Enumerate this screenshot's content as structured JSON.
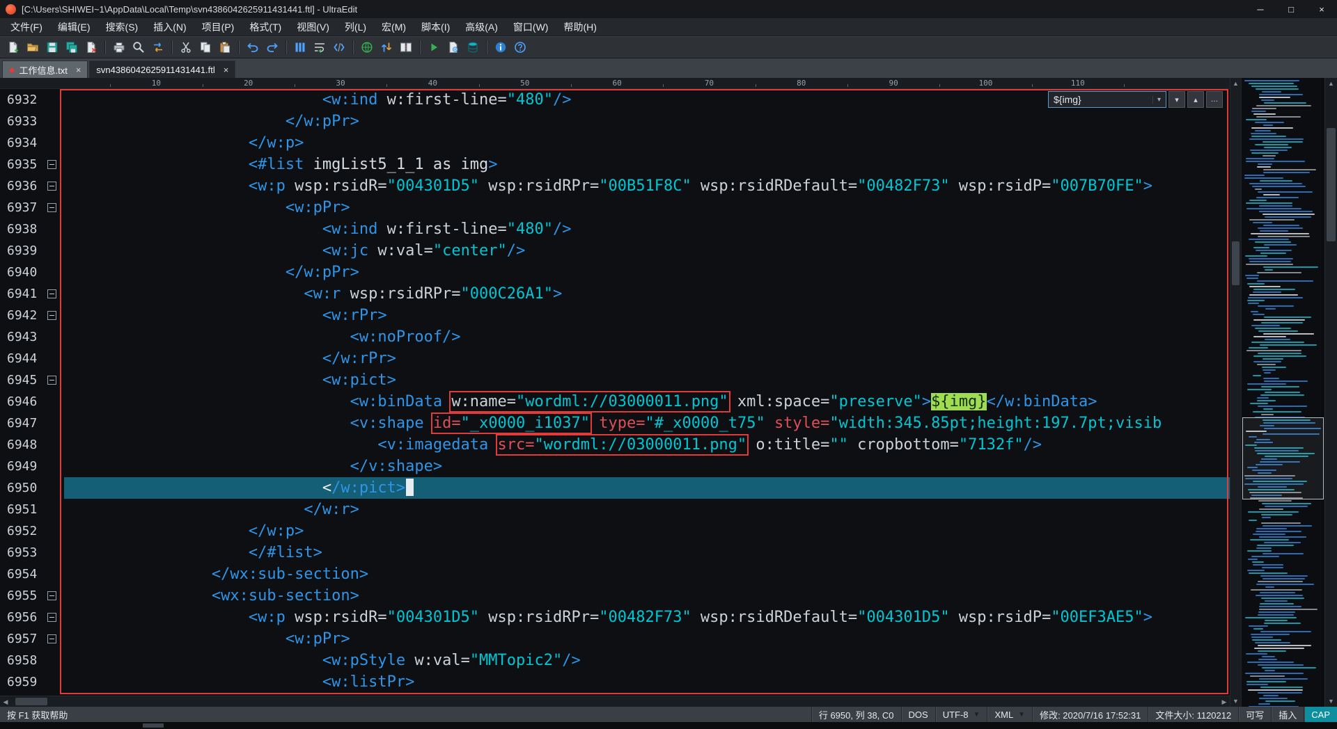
{
  "window": {
    "title": "[C:\\Users\\SHIWEI~1\\AppData\\Local\\Temp\\svn4386042625911431441.ftl] - UltraEdit",
    "controls": [
      {
        "name": "minimize"
      },
      {
        "name": "maximize"
      },
      {
        "name": "close"
      }
    ]
  },
  "menu": [
    "文件(F)",
    "编辑(E)",
    "搜索(S)",
    "插入(N)",
    "项目(P)",
    "格式(T)",
    "视图(V)",
    "列(L)",
    "宏(M)",
    "脚本(I)",
    "高级(A)",
    "窗口(W)",
    "帮助(H)"
  ],
  "toolbar": {
    "icons": [
      "new-file",
      "open-file",
      "save",
      "save-all",
      "close-file",
      "|",
      "print",
      "find",
      "replace",
      "|",
      "cut",
      "copy",
      "paste",
      "|",
      "undo",
      "redo",
      "|",
      "column-mode",
      "word-wrap",
      "html-tags",
      "|",
      "globe",
      "ftp",
      "compare-files",
      "|",
      "play-macro",
      "script",
      "database",
      "|",
      "info",
      "help"
    ]
  },
  "tabs": [
    {
      "label": "工作信息.txt",
      "modified": true,
      "active": false
    },
    {
      "label": "svn4386042625911431441.ftl",
      "modified": false,
      "active": true
    }
  ],
  "ruler": {
    "marks": [
      10,
      20,
      30,
      40,
      50,
      60,
      70,
      80,
      90,
      100,
      110
    ]
  },
  "find": {
    "value": "${img}"
  },
  "editor": {
    "lines": [
      {
        "num": 6932,
        "indent": 28,
        "tokens": [
          [
            "t",
            "<w:ind"
          ],
          [
            "a",
            " w:first-line="
          ],
          [
            "v",
            "\"480\""
          ],
          [
            "t",
            "/>"
          ]
        ]
      },
      {
        "num": 6933,
        "indent": 24,
        "tokens": [
          [
            "t",
            "</w:pPr>"
          ]
        ]
      },
      {
        "num": 6934,
        "indent": 20,
        "tokens": [
          [
            "t",
            "</w:p>"
          ]
        ]
      },
      {
        "num": 6935,
        "indent": 20,
        "fold": true,
        "tokens": [
          [
            "t",
            "<#list"
          ],
          [
            "p",
            " imgList5_1_1 as img"
          ],
          [
            "t",
            ">"
          ]
        ]
      },
      {
        "num": 6936,
        "indent": 20,
        "fold": true,
        "tokens": [
          [
            "t",
            "<w:p"
          ],
          [
            "a",
            " wsp:rsidR="
          ],
          [
            "v",
            "\"004301D5\""
          ],
          [
            "a",
            " wsp:rsidRPr="
          ],
          [
            "v",
            "\"00B51F8C\""
          ],
          [
            "a",
            " wsp:rsidRDefault="
          ],
          [
            "v",
            "\"00482F73\""
          ],
          [
            "a",
            " wsp:rsidP="
          ],
          [
            "v",
            "\"007B70FE\""
          ],
          [
            "t",
            ">"
          ]
        ]
      },
      {
        "num": 6937,
        "indent": 24,
        "fold": true,
        "tokens": [
          [
            "t",
            "<w:pPr>"
          ]
        ]
      },
      {
        "num": 6938,
        "indent": 28,
        "tokens": [
          [
            "t",
            "<w:ind"
          ],
          [
            "a",
            " w:first-line="
          ],
          [
            "v",
            "\"480\""
          ],
          [
            "t",
            "/>"
          ]
        ]
      },
      {
        "num": 6939,
        "indent": 28,
        "tokens": [
          [
            "t",
            "<w:jc"
          ],
          [
            "a",
            " w:val="
          ],
          [
            "v",
            "\"center\""
          ],
          [
            "t",
            "/>"
          ]
        ]
      },
      {
        "num": 6940,
        "indent": 24,
        "tokens": [
          [
            "t",
            "</w:pPr>"
          ]
        ]
      },
      {
        "num": 6941,
        "indent": 26,
        "fold": true,
        "tokens": [
          [
            "t",
            "<w:r"
          ],
          [
            "a",
            " wsp:rsidRPr="
          ],
          [
            "v",
            "\"000C26A1\""
          ],
          [
            "t",
            ">"
          ]
        ]
      },
      {
        "num": 6942,
        "indent": 28,
        "fold": true,
        "tokens": [
          [
            "t",
            "<w:rPr>"
          ]
        ]
      },
      {
        "num": 6943,
        "indent": 31,
        "tokens": [
          [
            "t",
            "<w:noProof/>"
          ]
        ]
      },
      {
        "num": 6944,
        "indent": 28,
        "tokens": [
          [
            "t",
            "</w:rPr>"
          ]
        ]
      },
      {
        "num": 6945,
        "indent": 28,
        "fold": true,
        "tokens": [
          [
            "t",
            "<w:pict>"
          ]
        ]
      },
      {
        "num": 6946,
        "indent": 31,
        "tokens": [
          [
            "t",
            "<w:binData"
          ],
          [
            "p",
            " "
          ],
          [
            "box",
            [
              [
                "a",
                "w:name="
              ],
              [
                "v",
                "\"wordml://03000011.png\""
              ]
            ]
          ],
          [
            "a",
            " xml:space="
          ],
          [
            "v",
            "\"preserve\""
          ],
          [
            "t",
            ">"
          ],
          [
            "hl",
            "${img}"
          ],
          [
            "t",
            "</w:binData>"
          ]
        ]
      },
      {
        "num": 6947,
        "indent": 31,
        "tokens": [
          [
            "t",
            "<v:shape"
          ],
          [
            "p",
            " "
          ],
          [
            "box",
            [
              [
                "r",
                "id="
              ],
              [
                "v",
                "\"_x0000_i1037\""
              ]
            ]
          ],
          [
            "p",
            " "
          ],
          [
            "r",
            "type="
          ],
          [
            "v",
            "\"#_x0000_t75\""
          ],
          [
            "p",
            " "
          ],
          [
            "r",
            "style="
          ],
          [
            "v",
            "\"width:345.85pt;height:197.7pt;visib"
          ]
        ]
      },
      {
        "num": 6948,
        "indent": 34,
        "tokens": [
          [
            "t",
            "<v:imagedata"
          ],
          [
            "p",
            " "
          ],
          [
            "box",
            [
              [
                "r",
                "src="
              ],
              [
                "v",
                "\"wordml://03000011.png\""
              ]
            ]
          ],
          [
            "a",
            " o:title="
          ],
          [
            "v",
            "\"\""
          ],
          [
            "a",
            " cropbottom="
          ],
          [
            "v",
            "\"7132f\""
          ],
          [
            "t",
            "/>"
          ]
        ]
      },
      {
        "num": 6949,
        "indent": 31,
        "tokens": [
          [
            "t",
            "</v:shape>"
          ]
        ]
      },
      {
        "num": 6950,
        "indent": 28,
        "current": true,
        "tokens": [
          [
            "w",
            "<"
          ],
          [
            "t",
            "/w:pict>"
          ],
          [
            "caret",
            ""
          ]
        ]
      },
      {
        "num": 6951,
        "indent": 26,
        "tokens": [
          [
            "t",
            "</w:r>"
          ]
        ]
      },
      {
        "num": 6952,
        "indent": 20,
        "tokens": [
          [
            "t",
            "</w:p>"
          ]
        ]
      },
      {
        "num": 6953,
        "indent": 20,
        "tokens": [
          [
            "t",
            "</#list>"
          ]
        ]
      },
      {
        "num": 6954,
        "indent": 16,
        "tokens": [
          [
            "t",
            "</wx:sub-section>"
          ]
        ]
      },
      {
        "num": 6955,
        "indent": 16,
        "fold": true,
        "tokens": [
          [
            "t",
            "<wx:sub-section>"
          ]
        ]
      },
      {
        "num": 6956,
        "indent": 20,
        "fold": true,
        "tokens": [
          [
            "t",
            "<w:p"
          ],
          [
            "a",
            " wsp:rsidR="
          ],
          [
            "v",
            "\"004301D5\""
          ],
          [
            "a",
            " wsp:rsidRPr="
          ],
          [
            "v",
            "\"00482F73\""
          ],
          [
            "a",
            " wsp:rsidRDefault="
          ],
          [
            "v",
            "\"004301D5\""
          ],
          [
            "a",
            " wsp:rsidP="
          ],
          [
            "v",
            "\"00EF3AE5\""
          ],
          [
            "t",
            ">"
          ]
        ]
      },
      {
        "num": 6957,
        "indent": 24,
        "fold": true,
        "tokens": [
          [
            "t",
            "<w:pPr>"
          ]
        ]
      },
      {
        "num": 6958,
        "indent": 28,
        "tokens": [
          [
            "t",
            "<w:pStyle"
          ],
          [
            "a",
            " w:val="
          ],
          [
            "v",
            "\"MMTopic2\""
          ],
          [
            "t",
            "/>"
          ]
        ]
      },
      {
        "num": 6959,
        "indent": 28,
        "tokens": [
          [
            "t",
            "<w:listPr>"
          ]
        ]
      }
    ]
  },
  "status_bar": {
    "help": "按 F1 获取帮助",
    "position": "行 6950, 列 38, C0",
    "line_ending": "DOS",
    "encoding": "UTF-8",
    "syntax": "XML",
    "modified": "修改: 2020/7/16 17:52:31",
    "file_size": "文件大小: 1120212",
    "writable": "可写",
    "insert_mode": "插入",
    "caps": "CAP"
  }
}
